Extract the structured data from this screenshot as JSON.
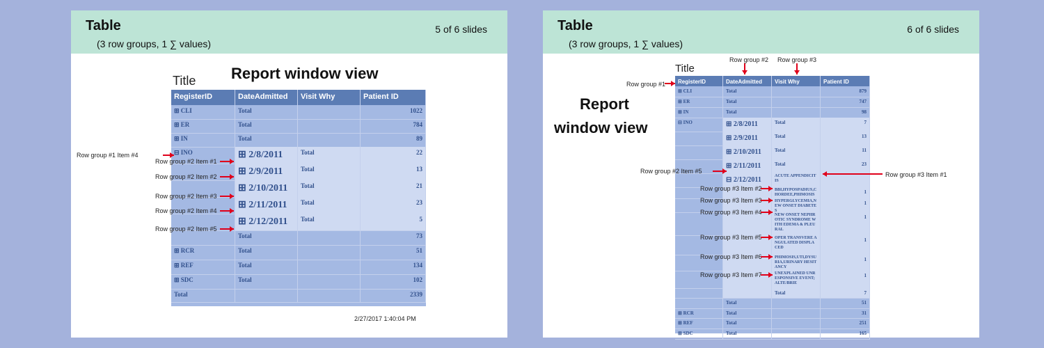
{
  "slides": [
    {
      "header": {
        "title": "Table",
        "subtitle": "(3 row groups, 1 ∑ values)",
        "counter": "5 of 6 slides"
      },
      "report_title": "Title",
      "report_window_label": "Report window view",
      "columns": [
        "RegisterID",
        "DateAdmitted",
        "Visit Why",
        "Patient ID"
      ],
      "rows": [
        {
          "c": [
            "⊞ CLI",
            "Total",
            "",
            "1022"
          ]
        },
        {
          "c": [
            "⊞ ER",
            "Total",
            "",
            "784"
          ]
        },
        {
          "c": [
            "⊞ IN",
            "Total",
            "",
            "89"
          ]
        },
        {
          "c": [
            "⊟ INO",
            "⊞   2/8/2011",
            "Total",
            "22"
          ]
        },
        {
          "c": [
            "",
            "⊞   2/9/2011",
            "Total",
            "13"
          ]
        },
        {
          "c": [
            "",
            "⊞   2/10/2011",
            "Total",
            "21"
          ]
        },
        {
          "c": [
            "",
            "⊞   2/11/2011",
            "Total",
            "23"
          ]
        },
        {
          "c": [
            "",
            "⊞   2/12/2011",
            "Total",
            "5"
          ]
        },
        {
          "c": [
            "",
            "Total",
            "",
            "73"
          ]
        },
        {
          "c": [
            "⊞ RCR",
            "Total",
            "",
            "51"
          ]
        },
        {
          "c": [
            "⊞ REF",
            "Total",
            "",
            "134"
          ]
        },
        {
          "c": [
            "⊞ SDC",
            "Total",
            "",
            "102"
          ]
        },
        {
          "c": [
            "Total",
            "",
            "",
            "2339"
          ]
        }
      ],
      "annotations": [
        "Row group #1 Item #4",
        "Row group #2 Item #1",
        "Row group #2 Item #2",
        "Row group #2 Item #3",
        "Row group #2 Item #4",
        "Row group #2 Item #5"
      ],
      "timestamp": "2/27/2017  1:40:04 PM"
    },
    {
      "header": {
        "title": "Table",
        "subtitle": "(3 row groups, 1 ∑ values)",
        "counter": "6 of 6 slides"
      },
      "report_title": "Title",
      "report_window_label": [
        "Report",
        "window view"
      ],
      "columns": [
        "RegisterID",
        "DateAdmitted",
        "Visit Why",
        "Patient ID"
      ],
      "rows": [
        {
          "c": [
            "⊞ CLI",
            "Total",
            "",
            "879"
          ]
        },
        {
          "c": [
            "⊞ ER",
            "Total",
            "",
            "747"
          ]
        },
        {
          "c": [
            "⊞ IN",
            "Total",
            "",
            "98"
          ]
        },
        {
          "c": [
            "⊟ INO",
            "⊞   2/8/2011",
            "Total",
            "7"
          ]
        },
        {
          "c": [
            "",
            "⊞   2/9/2011",
            "Total",
            "13"
          ]
        },
        {
          "c": [
            "",
            "⊞  2/10/2011",
            "Total",
            "11"
          ]
        },
        {
          "c": [
            "",
            "⊞  2/11/2011",
            "Total",
            "23"
          ]
        },
        {
          "c": [
            "",
            "⊟  2/12/2011",
            "ACUTE APPENDICITIS",
            ""
          ]
        },
        {
          "c": [
            "",
            "",
            "BBI,HYPOSPADIUS,CHORDEE,PHIMOSIS",
            "1"
          ]
        },
        {
          "c": [
            "",
            "",
            "HYPERGLYCEMIA,NEW ONSET DIABETES",
            "1"
          ]
        },
        {
          "c": [
            "",
            "",
            "NEW ONSET NEPHROTIC SYNDROME WITH EDEMA & PLEURAL",
            "1"
          ]
        },
        {
          "c": [
            "",
            "",
            "OPER TRANSVERE ANGULATED DISPLACED",
            "1"
          ]
        },
        {
          "c": [
            "",
            "",
            "PHIMOSIS,UTI,DYSURIA,URINARY HESITANCY",
            "1"
          ]
        },
        {
          "c": [
            "",
            "",
            "UNEXPLAINED UNRESPONSIVE EVENT;ALTE/BRIE",
            "1"
          ]
        },
        {
          "c": [
            "",
            "",
            "Total",
            "7"
          ]
        },
        {
          "c": [
            "",
            "Total",
            "",
            "51"
          ]
        },
        {
          "c": [
            "⊞ RCR",
            "Total",
            "",
            "31"
          ]
        },
        {
          "c": [
            "⊞ REF",
            "Total",
            "",
            "251"
          ]
        },
        {
          "c": [
            "⊞ SDC",
            "Total",
            "",
            "165"
          ]
        }
      ],
      "top_labels": [
        "Row group #2",
        "Row group #3"
      ],
      "annotations": [
        "Row group #1",
        "Row group #2 Item #5",
        "Row group #3 Item #1",
        "Row group #3 Item #2",
        "Row group #3 Item #3",
        "Row group #3 Item #4",
        "Row group #3 Item #5",
        "Row group #3 Item #6",
        "Row group #3 Item #7"
      ]
    }
  ],
  "colors": {
    "background": "#a4b2dc",
    "header_band": "#bde4d6",
    "table_body": "#a4b9e3",
    "table_header": "#5b7cb4",
    "arrow": "#e0001a"
  }
}
